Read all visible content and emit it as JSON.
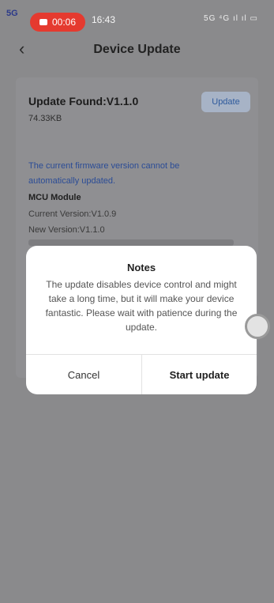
{
  "status_bar": {
    "carrier": "5G",
    "recording_time": "00:06",
    "clock": "16:43",
    "system_icons": "5G ⁴G ıl ıl ▭"
  },
  "header": {
    "back_symbol": "‹",
    "title": "Device Update"
  },
  "update_card": {
    "title": "Update Found:V1.1.0",
    "size": "74.33KB",
    "update_button": "Update",
    "warning": "The current firmware version cannot be automatically updated.",
    "module_name": "MCU Module",
    "current_version": "Current Version:V1.0.9",
    "new_version": "New Version:V1.1.0"
  },
  "dialog": {
    "title": "Notes",
    "body": "The update disables device control and might take a long time, but it will make your device fantastic. Please wait with patience during the update.",
    "cancel_label": "Cancel",
    "start_label": "Start update"
  },
  "colors": {
    "overlay": "#8a8a8c",
    "accent_blue": "#2b4c96",
    "record_red": "#e53a2f"
  },
  "icons": [
    "back-arrow-icon",
    "record-icon",
    "signal-icon",
    "battery-icon",
    "assistive-touch-icon"
  ]
}
